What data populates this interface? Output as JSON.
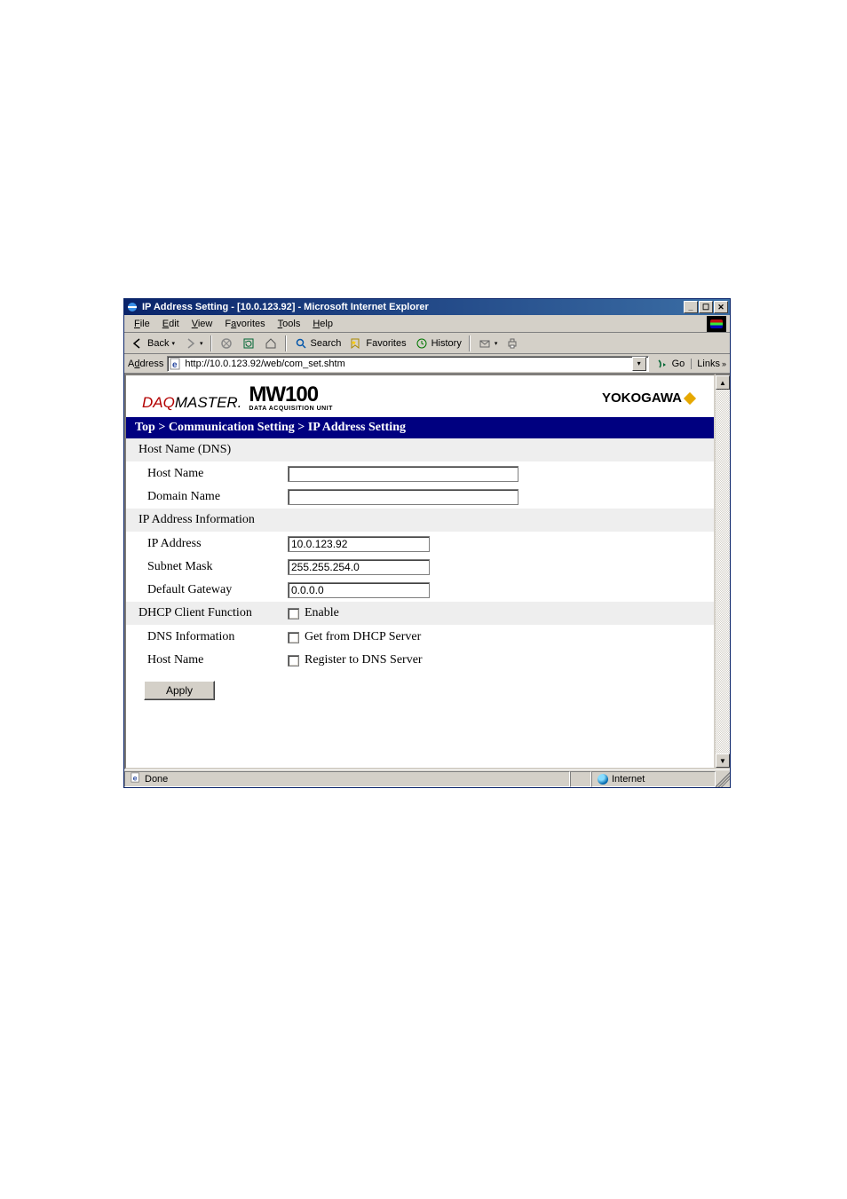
{
  "window": {
    "title": "IP Address Setting - [10.0.123.92] - Microsoft Internet Explorer",
    "min_tip": "Minimize",
    "max_tip": "Maximize",
    "close_tip": "Close"
  },
  "menu": {
    "file": "File",
    "edit": "Edit",
    "view": "View",
    "favorites": "Favorites",
    "tools": "Tools",
    "help": "Help"
  },
  "toolbar": {
    "back": "Back",
    "search": "Search",
    "favorites": "Favorites",
    "history": "History"
  },
  "addressbar": {
    "label": "Address",
    "url": "http://10.0.123.92/web/com_set.shtm",
    "go": "Go",
    "links": "Links"
  },
  "brand": {
    "daq": "DAQ",
    "master": "MASTER.",
    "product": "MW100",
    "sub": "DATA ACQUISITION UNIT",
    "yokogawa": "YOKOGAWA"
  },
  "breadcrumb": {
    "top": "Top",
    "sep1": " > ",
    "comm": "Communication Setting",
    "sep2": " > ",
    "ip": "IP Address Setting"
  },
  "form": {
    "sec_hostdns": "Host Name (DNS)",
    "host_name_lbl": "Host Name",
    "host_name_val": "",
    "domain_name_lbl": "Domain Name",
    "domain_name_val": "",
    "sec_ipinfo": "IP Address Information",
    "ip_lbl": "IP Address",
    "ip_val": "10.0.123.92",
    "subnet_lbl": "Subnet Mask",
    "subnet_val": "255.255.254.0",
    "gateway_lbl": "Default Gateway",
    "gateway_val": "0.0.0.0",
    "sec_dhcp_client": "DHCP Client Function",
    "dhcp_enable_lbl": "Enable",
    "dns_info_lbl": "DNS Information",
    "dns_get_lbl": "Get from DHCP Server",
    "hostname2_lbl": "Host Name",
    "register_lbl": "Register to DNS Server",
    "apply": "Apply"
  },
  "status": {
    "done": "Done",
    "zone": "Internet"
  }
}
